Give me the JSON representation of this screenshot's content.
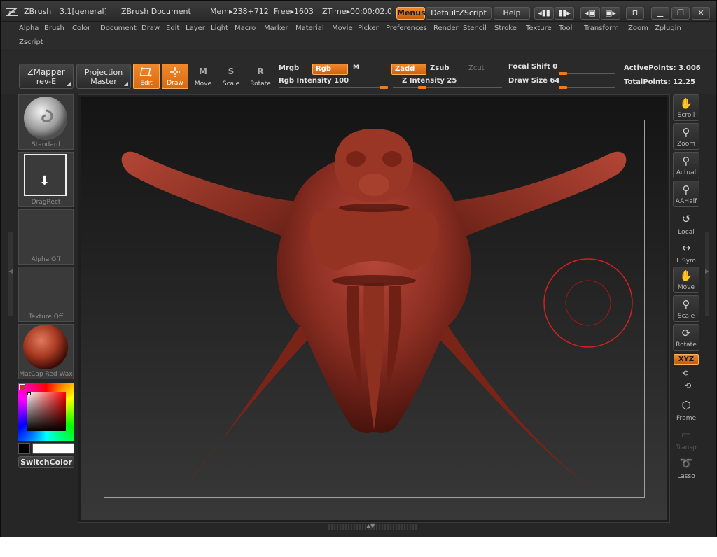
{
  "titlebar": {
    "app_name": "ZBrush",
    "version": "3.1[general]",
    "document": "ZBrush Document",
    "mem": "Mem▸238+712",
    "free": "Free▸1603",
    "ztime": "ZTime▸00:00:02.0",
    "menus_label": "Menus",
    "zscript_label": "DefaultZScript",
    "help_label": "Help",
    "minimize_glyph": "▁",
    "maximize_glyph": "❐",
    "close_glyph": "✕"
  },
  "menubar": {
    "items": [
      "Alpha",
      "Brush",
      "Color",
      "Document",
      "Draw",
      "Edit",
      "Layer",
      "Light",
      "Macro",
      "Marker",
      "Material",
      "Movie",
      "Picker",
      "Preferences",
      "Render",
      "Stencil",
      "Stroke",
      "Texture",
      "Tool",
      "Transform",
      "Zoom",
      "Zplugin"
    ],
    "second_row": [
      "Zscript"
    ]
  },
  "shelf": {
    "zmapper_title": "ZMapper",
    "zmapper_sub": "rev-E",
    "projection_title": "Projection",
    "projection_sub": "Master",
    "tools": [
      {
        "label": "Edit",
        "active": true,
        "icon": "edit-icon"
      },
      {
        "label": "Draw",
        "active": true,
        "icon": "draw-icon"
      },
      {
        "label": "Move",
        "active": false,
        "icon": "move-icon",
        "glyph": "M"
      },
      {
        "label": "Scale",
        "active": false,
        "icon": "scale-icon",
        "glyph": "S"
      },
      {
        "label": "Rotate",
        "active": false,
        "icon": "rotate-icon",
        "glyph": "R"
      }
    ],
    "mrgb": "Mrgb",
    "rgb": "Rgb",
    "m": "M",
    "zadd": "Zadd",
    "zsub": "Zsub",
    "zcut": "Zcut",
    "rgb_intensity_label": "Rgb Intensity",
    "rgb_intensity_value": "100",
    "rgb_intensity_fraction": 1.0,
    "z_intensity_label": "Z Intensity",
    "z_intensity_value": "25",
    "z_intensity_fraction": 0.25,
    "focal_shift_label": "Focal Shift",
    "focal_shift_value": "0",
    "focal_shift_fraction": 0.0,
    "draw_size_label": "Draw Size",
    "draw_size_value": "64",
    "draw_size_fraction": 0.0,
    "active_points": "ActivePoints: 3.006",
    "total_points": "TotalPoints: 12.25"
  },
  "lefttray": {
    "brush_label": "Standard",
    "stroke_label": "DragRect",
    "alpha_label": "Alpha Off",
    "texture_label": "Texture Off",
    "material_label": "MatCap Red Wax",
    "switchcolor_label": "SwitchColor"
  },
  "righttray": {
    "buttons": [
      {
        "label": "Scroll",
        "icon": "scroll-icon"
      },
      {
        "label": "Zoom",
        "icon": "zoom-icon"
      },
      {
        "label": "Actual",
        "icon": "actual-icon"
      },
      {
        "label": "AAHalf",
        "icon": "aahalf-icon"
      },
      {
        "label": "Local",
        "icon": "local-icon"
      },
      {
        "label": "L.Sym",
        "icon": "lsym-icon"
      },
      {
        "label": "Move",
        "icon": "move-icon"
      },
      {
        "label": "Scale",
        "icon": "scale-icon"
      },
      {
        "label": "Rotate",
        "icon": "rotate-icon"
      },
      {
        "label": "Frame",
        "icon": "frame-icon"
      },
      {
        "label": "Transp",
        "icon": "transp-icon"
      },
      {
        "label": "Lasso",
        "icon": "lasso-icon"
      }
    ],
    "xyz_label": "XYZ"
  },
  "colors": {
    "accent": "#f07a18",
    "model": "#8a2e22",
    "brush_ring": "#d42020",
    "canvas_bg": "#262626"
  }
}
